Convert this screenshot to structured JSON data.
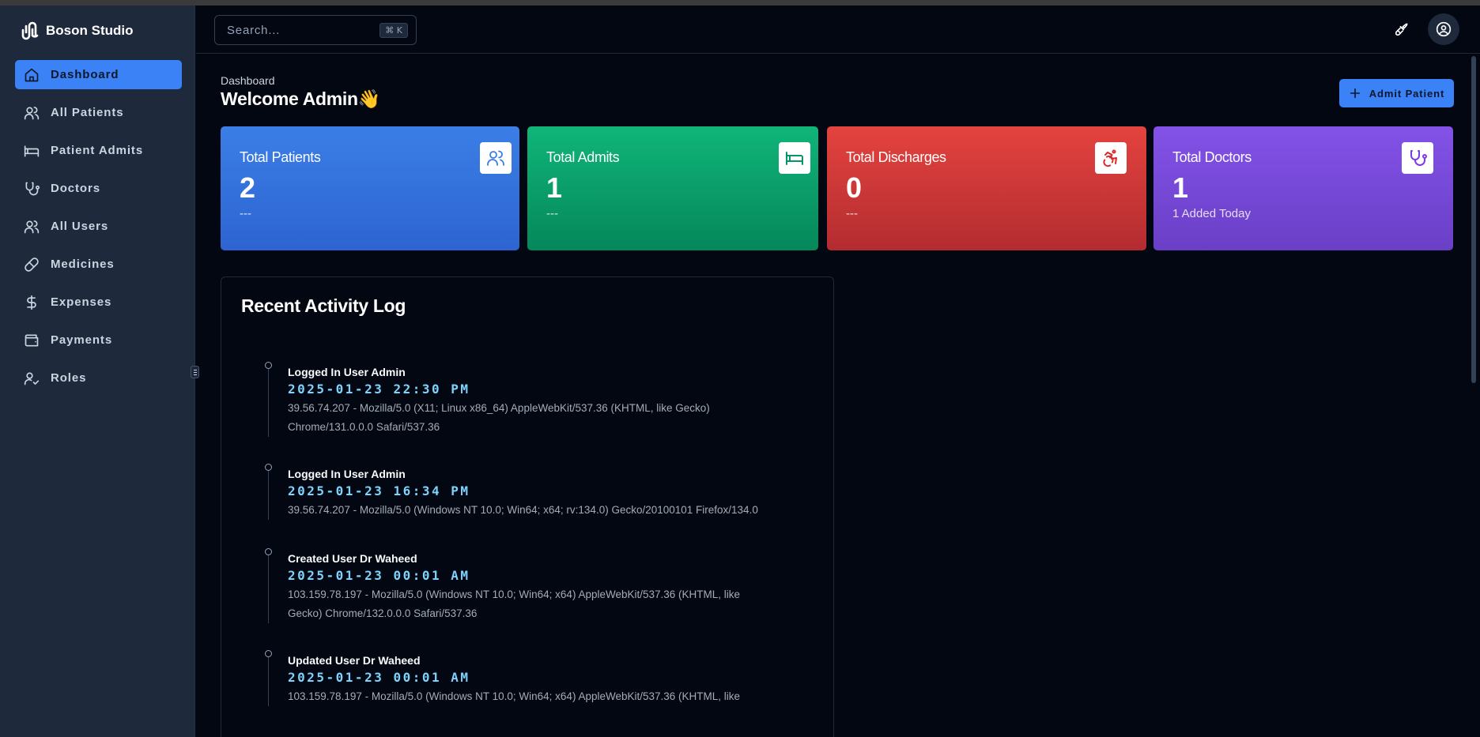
{
  "brand": {
    "name": "Boson Studio"
  },
  "sidebar": {
    "items": [
      {
        "label": "Dashboard",
        "icon": "home-icon",
        "active": true
      },
      {
        "label": "All Patients",
        "icon": "users-icon"
      },
      {
        "label": "Patient Admits",
        "icon": "bed-icon"
      },
      {
        "label": "Doctors",
        "icon": "stethoscope-icon"
      },
      {
        "label": "All Users",
        "icon": "users-icon"
      },
      {
        "label": "Medicines",
        "icon": "pill-icon"
      },
      {
        "label": "Expenses",
        "icon": "dollar-icon"
      },
      {
        "label": "Payments",
        "icon": "wallet-icon"
      },
      {
        "label": "Roles",
        "icon": "user-check-icon"
      }
    ]
  },
  "header": {
    "search": {
      "placeholder": "Search...",
      "shortcut": "⌘ K"
    }
  },
  "page": {
    "breadcrumb": "Dashboard",
    "title": "Welcome Admin👋",
    "admit_button": "Admit Patient"
  },
  "cards": [
    {
      "title": "Total Patients",
      "value": "2",
      "sub": "---",
      "color": "#3b7ee6",
      "icon": "users-icon"
    },
    {
      "title": "Total Admits",
      "value": "1",
      "sub": "---",
      "color": "#10b57a",
      "icon": "bed-icon"
    },
    {
      "title": "Total Discharges",
      "value": "0",
      "sub": "---",
      "color": "#e4433f",
      "icon": "accessibility-icon"
    },
    {
      "title": "Total Doctors",
      "value": "1",
      "sub": "1 Added Today",
      "color": "#8352e8",
      "icon": "stethoscope-icon"
    }
  ],
  "activity": {
    "title": "Recent Activity Log",
    "items": [
      {
        "action": "Logged In User Admin",
        "time": "2025-01-23 22:30 PM",
        "detail_line1": "39.56.74.207 - Mozilla/5.0 (X11; Linux x86_64) AppleWebKit/537.36 (KHTML, like Gecko)",
        "detail_line2": "Chrome/131.0.0.0 Safari/537.36"
      },
      {
        "action": "Logged In User Admin",
        "time": "2025-01-23 16:34 PM",
        "detail_line1": "39.56.74.207 - Mozilla/5.0 (Windows NT 10.0; Win64; x64; rv:134.0) Gecko/20100101 Firefox/134.0",
        "detail_line2": ""
      },
      {
        "action": "Created User Dr Waheed",
        "time": "2025-01-23 00:01 AM",
        "detail_line1": "103.159.78.197 - Mozilla/5.0 (Windows NT 10.0; Win64; x64) AppleWebKit/537.36 (KHTML, like",
        "detail_line2": "Gecko) Chrome/132.0.0.0 Safari/537.36"
      },
      {
        "action": "Updated User Dr Waheed",
        "time": "2025-01-23 00:01 AM",
        "detail_line1": "103.159.78.197 - Mozilla/5.0 (Windows NT 10.0; Win64; x64) AppleWebKit/537.36 (KHTML, like",
        "detail_line2": ""
      }
    ]
  },
  "colors": {
    "accent": "#3b82f6",
    "sidebar_bg": "#1e293b",
    "page_bg": "#030712",
    "timestamp": "#7dd3fc"
  }
}
